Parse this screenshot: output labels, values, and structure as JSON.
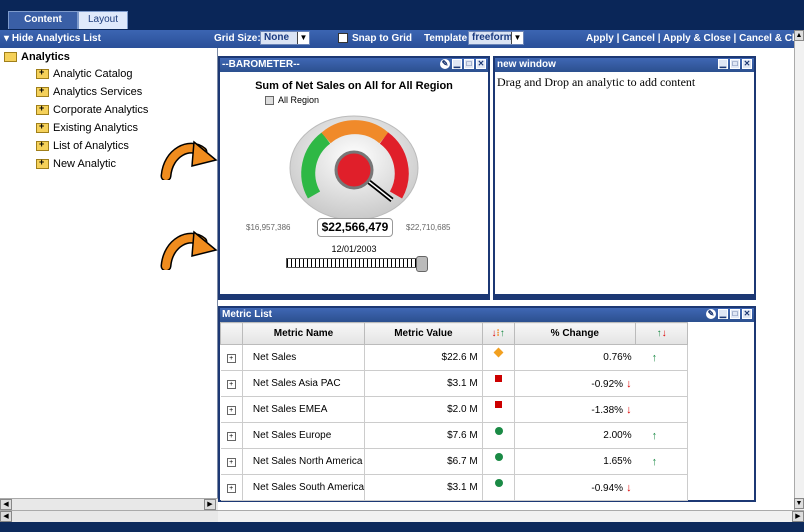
{
  "tabs": [
    {
      "label": "Content"
    },
    {
      "label": "Layout"
    }
  ],
  "toolbar": {
    "hide_list": "Hide Analytics List",
    "grid_size_label": "Grid Size:",
    "grid_size_value": "None",
    "snap_label": "Snap to Grid",
    "template_label": "Template:",
    "template_value": "freeform",
    "apply": "Apply",
    "cancel": "Cancel",
    "apply_close": "Apply & Close",
    "cancel_close": "Cancel & Close",
    "separator": "|"
  },
  "tree": {
    "root": "Analytics",
    "items": [
      {
        "label": "Analytic Catalog"
      },
      {
        "label": "Analytics Services"
      },
      {
        "label": "Corporate Analytics"
      },
      {
        "label": "Existing Analytics"
      },
      {
        "label": "List of Analytics"
      },
      {
        "label": "New Analytic"
      }
    ]
  },
  "barometer": {
    "window_title": "--BAROMETER--",
    "title": "Sum of Net Sales on All  for All Region",
    "legend": "All Region",
    "min_label": "$16,957,386",
    "max_label": "$22,710,685",
    "value": "$22,566,479",
    "date": "12/01/2003",
    "slider_position": 1.0,
    "colors": {
      "green": "#2eb845",
      "orange": "#f08a2a",
      "red": "#e01f2a"
    }
  },
  "new_window": {
    "title": "new window",
    "text": "Drag and Drop an analytic to add content"
  },
  "metric_list": {
    "title": "Metric List",
    "headers": [
      "Metric Name",
      "Metric Value",
      "% Change"
    ],
    "rows": [
      {
        "name": "Net Sales",
        "value": "$22.6 M",
        "status": "diamond",
        "change": "0.76%",
        "trend": "up"
      },
      {
        "name": "Net Sales Asia PAC",
        "value": "$3.1 M",
        "status": "square",
        "change": "-0.92%",
        "trend": "down"
      },
      {
        "name": "Net Sales EMEA",
        "value": "$2.0 M",
        "status": "square",
        "change": "-1.38%",
        "trend": "down"
      },
      {
        "name": "Net Sales Europe",
        "value": "$7.6 M",
        "status": "circle",
        "change": "2.00%",
        "trend": "up"
      },
      {
        "name": "Net Sales North America",
        "value": "$6.7 M",
        "status": "circle",
        "change": "1.65%",
        "trend": "up"
      },
      {
        "name": "Net Sales South America",
        "value": "$3.1 M",
        "status": "circle",
        "change": "-0.94%",
        "trend": "down"
      }
    ]
  },
  "icons": {
    "folder": "folder-icon",
    "close": "close-icon",
    "minimize": "minimize-icon",
    "maximize": "maximize-icon",
    "edit": "edit-icon",
    "arrow": "curved-arrow-icon"
  }
}
